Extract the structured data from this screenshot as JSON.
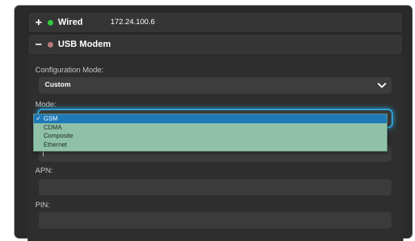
{
  "connections": [
    {
      "title": "Wired",
      "ip": "172.24.100.6",
      "toggle": "+",
      "status_color": "#2ecc40",
      "expanded": false
    },
    {
      "title": "USB Modem",
      "ip": "",
      "toggle": "−",
      "status_color": "#b97a7a",
      "expanded": true
    }
  ],
  "form": {
    "config_mode_label": "Configuration Mode:",
    "config_mode_value": "Custom",
    "mode_label": "Mode:",
    "mode_options": [
      "GSM",
      "CDMA",
      "Composite",
      "Ethernet"
    ],
    "mode_selected_check": "✓",
    "apn_label": "APN:",
    "apn_value": "",
    "pin_label": "PIN:",
    "pin_value": ""
  },
  "colors": {
    "accent": "#2aa7e0",
    "dropdown_bg": "#8fc1a8",
    "dropdown_selected": "#1e79b8"
  }
}
